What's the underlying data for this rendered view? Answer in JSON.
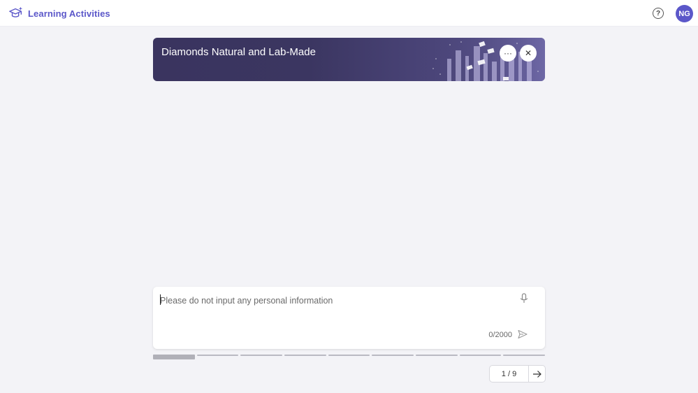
{
  "app": {
    "title": "Learning Activities",
    "brand_color": "#5b57c9"
  },
  "header": {
    "help_icon": "question-circle-icon",
    "help_glyph": "?",
    "avatar_initials": "NG"
  },
  "banner": {
    "title": "Diamonds Natural and Lab-Made",
    "more_glyph": "···",
    "close_glyph": "✕"
  },
  "composer": {
    "placeholder": "Please do not input any personal information",
    "counter": "0/2000",
    "mic_icon": "microphone-icon",
    "send_icon": "send-icon"
  },
  "progress": {
    "current_step": 1,
    "total_steps": 9
  },
  "pager": {
    "label": "1 / 9",
    "next_icon": "arrow-right-icon"
  }
}
